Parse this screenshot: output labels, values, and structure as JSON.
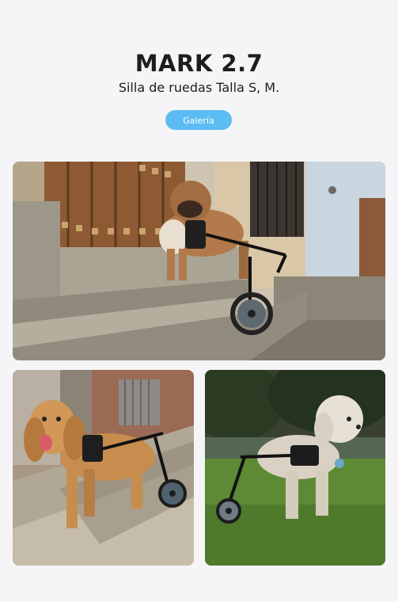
{
  "header": {
    "title": "MARK 2.7",
    "subtitle": "Silla de ruedas Talla S, M."
  },
  "gallery_button": {
    "label": "Galería"
  },
  "colors": {
    "background": "#f5f5f7",
    "accent": "#5bbcf3",
    "text": "#1d1d1f"
  },
  "photos": [
    {
      "name": "bulldog-on-steps-photo"
    },
    {
      "name": "cocker-spaniel-on-sidewalk-photo"
    },
    {
      "name": "poodle-on-grass-photo"
    }
  ]
}
